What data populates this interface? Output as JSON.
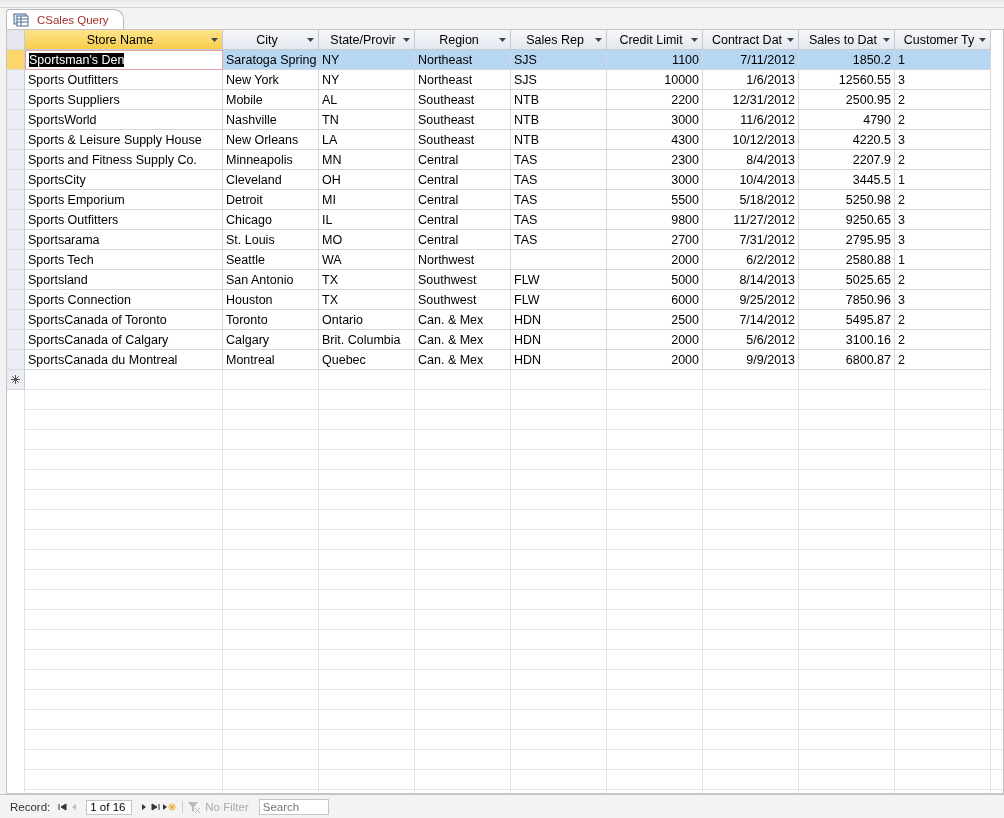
{
  "tab": {
    "title": "CSales Query",
    "selected": true
  },
  "table": {
    "columns": [
      {
        "label": "Store Name",
        "kind": "text",
        "selected": true
      },
      {
        "label": "City",
        "kind": "text",
        "selected": false
      },
      {
        "label": "State/Provir",
        "kind": "text",
        "selected": false
      },
      {
        "label": "Region",
        "kind": "text",
        "selected": false
      },
      {
        "label": "Sales Rep",
        "kind": "text",
        "selected": false
      },
      {
        "label": "Credit Limit",
        "kind": "number",
        "selected": false
      },
      {
        "label": "Contract Dat",
        "kind": "number",
        "selected": false
      },
      {
        "label": "Sales to Dat",
        "kind": "number",
        "selected": false
      },
      {
        "label": "Customer Ty",
        "kind": "text",
        "selected": false
      }
    ],
    "rows": [
      {
        "selected": true,
        "cells": [
          "Sportsman's Den",
          "Saratoga Spring",
          "NY",
          "Northeast",
          "SJS",
          "1100",
          "7/11/2012",
          "1850.2",
          "1"
        ]
      },
      {
        "selected": false,
        "cells": [
          "Sports Outfitters",
          "New York",
          "NY",
          "Northeast",
          "SJS",
          "10000",
          "1/6/2013",
          "12560.55",
          "3"
        ]
      },
      {
        "selected": false,
        "cells": [
          "Sports Suppliers",
          "Mobile",
          "AL",
          "Southeast",
          "NTB",
          "2200",
          "12/31/2012",
          "2500.95",
          "2"
        ]
      },
      {
        "selected": false,
        "cells": [
          "SportsWorld",
          "Nashville",
          "TN",
          "Southeast",
          "NTB",
          "3000",
          "11/6/2012",
          "4790",
          "2"
        ]
      },
      {
        "selected": false,
        "cells": [
          "Sports & Leisure Supply House",
          "New Orleans",
          "LA",
          "Southeast",
          "NTB",
          "4300",
          "10/12/2013",
          "4220.5",
          "3"
        ]
      },
      {
        "selected": false,
        "cells": [
          "Sports and Fitness Supply Co.",
          "Minneapolis",
          "MN",
          "Central",
          "TAS",
          "2300",
          "8/4/2013",
          "2207.9",
          "2"
        ]
      },
      {
        "selected": false,
        "cells": [
          "SportsCity",
          "Cleveland",
          "OH",
          "Central",
          "TAS",
          "3000",
          "10/4/2013",
          "3445.5",
          "1"
        ]
      },
      {
        "selected": false,
        "cells": [
          "Sports Emporium",
          "Detroit",
          "MI",
          "Central",
          "TAS",
          "5500",
          "5/18/2012",
          "5250.98",
          "2"
        ]
      },
      {
        "selected": false,
        "cells": [
          "Sports Outfitters",
          "Chicago",
          "IL",
          "Central",
          "TAS",
          "9800",
          "11/27/2012",
          "9250.65",
          "3"
        ]
      },
      {
        "selected": false,
        "cells": [
          "Sportsarama",
          "St. Louis",
          "MO",
          "Central",
          "TAS",
          "2700",
          "7/31/2012",
          "2795.95",
          "3"
        ]
      },
      {
        "selected": false,
        "cells": [
          "Sports Tech",
          "Seattle",
          "WA",
          "Northwest",
          "",
          "2000",
          "6/2/2012",
          "2580.88",
          "1"
        ]
      },
      {
        "selected": false,
        "cells": [
          "Sportsland",
          "San Antonio",
          "TX",
          "Southwest",
          "FLW",
          "5000",
          "8/14/2013",
          "5025.65",
          "2"
        ]
      },
      {
        "selected": false,
        "cells": [
          "Sports Connection",
          "Houston",
          "TX",
          "Southwest",
          "FLW",
          "6000",
          "9/25/2012",
          "7850.96",
          "3"
        ]
      },
      {
        "selected": false,
        "cells": [
          "SportsCanada of Toronto",
          "Toronto",
          "Ontario",
          "Can. & Mex",
          "HDN",
          "2500",
          "7/14/2012",
          "5495.87",
          "2"
        ]
      },
      {
        "selected": false,
        "cells": [
          "SportsCanada of Calgary",
          "Calgary",
          "Brit. Columbia",
          "Can. & Mex",
          "HDN",
          "2000",
          "5/6/2012",
          "3100.16",
          "2"
        ]
      },
      {
        "selected": false,
        "cells": [
          "SportsCanada du Montreal",
          "Montreal",
          "Quebec",
          "Can. & Mex",
          "HDN",
          "2000",
          "9/9/2013",
          "6800.87",
          "2"
        ]
      }
    ]
  },
  "status_bar": {
    "label": "Record:",
    "position": "1 of 16",
    "filter": {
      "label": "No Filter",
      "disabled": true
    },
    "search": {
      "placeholder": "Search"
    }
  }
}
